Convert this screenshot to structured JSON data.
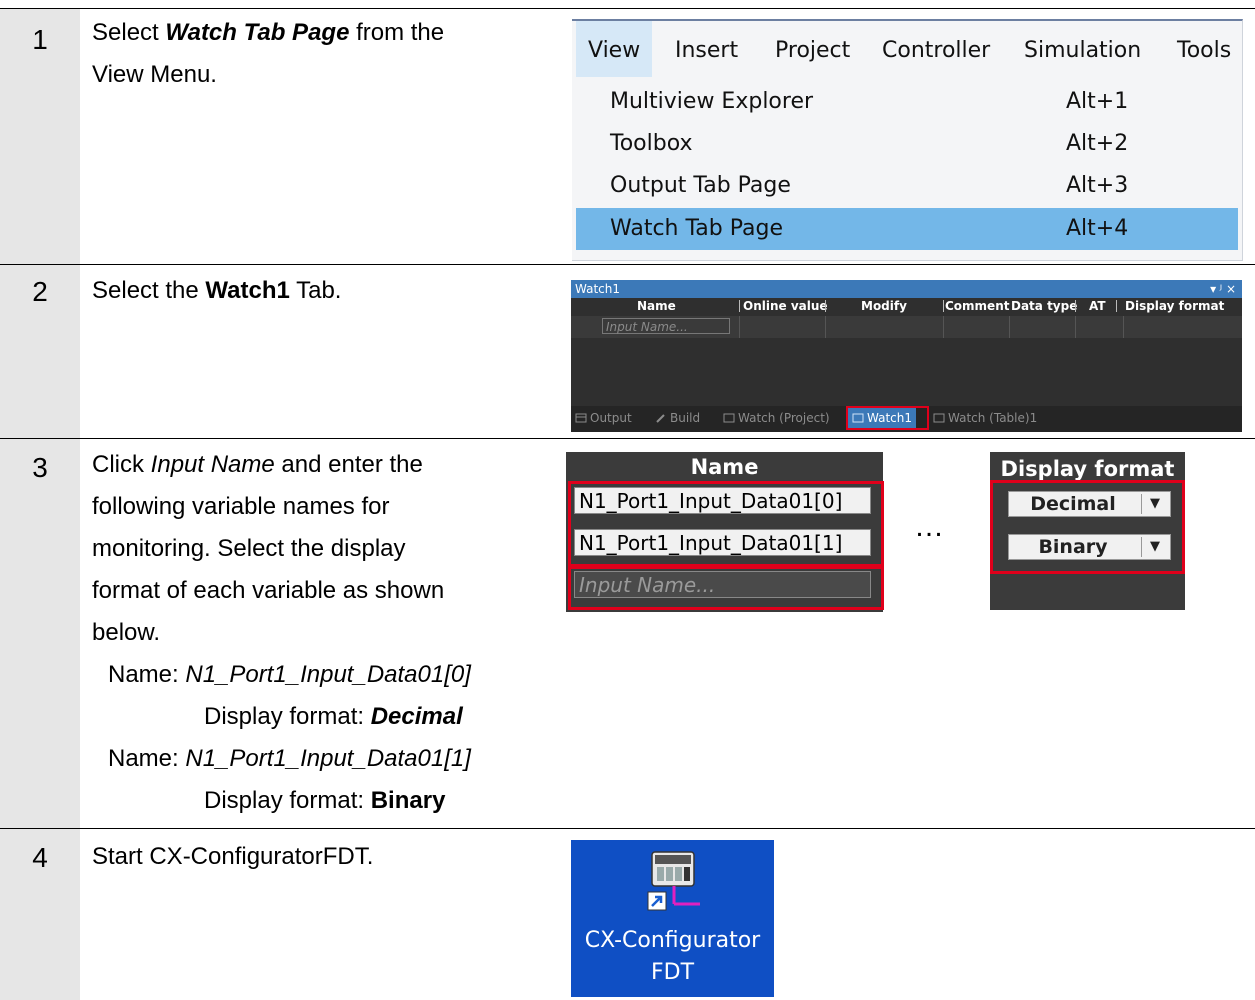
{
  "steps": [
    {
      "number": "1",
      "text_before": "Select ",
      "text_bold_italic": "Watch Tab Page",
      "text_after": " from the",
      "text_line2": "View Menu."
    },
    {
      "number": "2",
      "text_before": "Select the ",
      "text_bold": "Watch1",
      "text_after": " Tab."
    },
    {
      "number": "3",
      "line1_before": "Click ",
      "line1_italic": "Input Name",
      "line1_after": " and enter the",
      "line2": "following variable names for",
      "line3": "monitoring. Select the display",
      "line4": "format of each variable as shown",
      "line5": "below.",
      "var1_name_label": "Name: ",
      "var1_name": "N1_Port1_Input_Data01[0]",
      "var1_format_label": "Display format: ",
      "var1_format": "Decimal",
      "var2_name_label": "Name: ",
      "var2_name": "N1_Port1_Input_Data01[1]",
      "var2_format_label": "Display format: ",
      "var2_format": "Binary"
    },
    {
      "number": "4",
      "text": "Start CX-ConfiguratorFDT."
    }
  ],
  "view_menu": {
    "menubar": [
      "View",
      "Insert",
      "Project",
      "Controller",
      "Simulation",
      "Tools"
    ],
    "items": [
      {
        "label": "Multiview Explorer",
        "shortcut": "Alt+1"
      },
      {
        "label": "Toolbox",
        "shortcut": "Alt+2"
      },
      {
        "label": "Output Tab Page",
        "shortcut": "Alt+3"
      },
      {
        "label": "Watch Tab Page",
        "shortcut": "Alt+4"
      }
    ]
  },
  "watch_panel": {
    "title": "Watch1",
    "controls": "▾ ᴶ ×",
    "columns": [
      "Name",
      "Online value",
      "Modify",
      "Comment",
      "Data type",
      "AT",
      "Display format"
    ],
    "input_placeholder": "Input Name...",
    "tabs": [
      "Output",
      "Build",
      "Watch (Project)",
      "Watch1",
      "Watch (Table)1"
    ]
  },
  "name_column": {
    "header": "Name",
    "rows": [
      "N1_Port1_Input_Data01[0]",
      "N1_Port1_Input_Data01[1]"
    ],
    "placeholder": "Input Name..."
  },
  "ellipsis": "…",
  "format_column": {
    "header": "Display format",
    "values": [
      "Decimal",
      "Binary"
    ],
    "dropdown_arrow": "▼"
  },
  "app_icon": {
    "line1": "CX-Configurator",
    "line2": "FDT"
  },
  "colors": {
    "highlight_red": "#e0001b",
    "menu_selected": "#73b7e8",
    "watch_title_blue": "#3c79b8",
    "icon_blue": "#0f4fc4",
    "number_column_gray": "#e6e6e6"
  }
}
